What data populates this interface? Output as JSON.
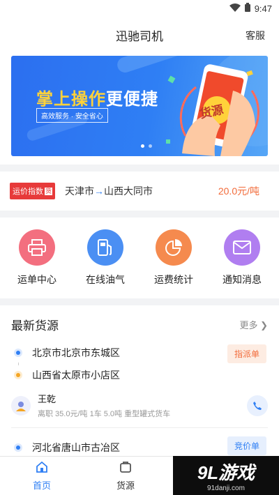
{
  "status": {
    "time": "9:47"
  },
  "header": {
    "title": "迅驰司机",
    "service": "客服"
  },
  "banner": {
    "headline_a": "掌上操作",
    "headline_b": "更便捷",
    "subtitle": "高效服务 · 安全省心",
    "phone_text": "货源"
  },
  "price_index": {
    "tag": "运价指数",
    "tag_box": "货",
    "route_from": "天津市",
    "arrow": "→",
    "route_to": "山西大同市",
    "value": "20.0元/吨"
  },
  "menu": [
    {
      "label": "运单中心",
      "icon": "printer-icon",
      "color": "#f36f7f"
    },
    {
      "label": "在线油气",
      "icon": "fuel-pump-icon",
      "color": "#4b8ff3"
    },
    {
      "label": "运费统计",
      "icon": "pie-chart-icon",
      "color": "#f58a4e"
    },
    {
      "label": "通知消息",
      "icon": "mail-icon",
      "color": "#b07ef0"
    }
  ],
  "cargo": {
    "title": "最新货源",
    "more": "更多 ❯",
    "items": [
      {
        "from": "北京市北京市东城区",
        "to": "山西省太原市小店区",
        "badge": "指派单",
        "driver": "王乾",
        "desc": "离职 35.0元/吨 1车 5.0吨 重型罐式货车"
      },
      {
        "from": "河北省唐山市古冶区",
        "badge": "竞价单"
      }
    ]
  },
  "tabs": [
    {
      "label": "首页",
      "icon": "home-icon",
      "active": true
    },
    {
      "label": "货源",
      "icon": "cargo-icon",
      "active": false
    }
  ],
  "watermark": {
    "big": "9L游戏",
    "small": "91danji.com"
  }
}
